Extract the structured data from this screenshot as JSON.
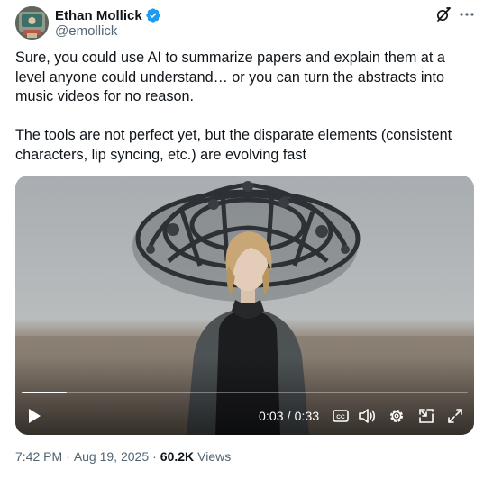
{
  "author": {
    "display_name": "Ethan Mollick",
    "handle": "@emollick",
    "verified": true
  },
  "icons": {
    "avatar": "avatar",
    "verified": "verified-badge-icon",
    "grok": "grok-icon",
    "more": "more-icon",
    "play": "play-icon",
    "captions": "closed-captions-icon",
    "volume": "volume-icon",
    "settings": "gear-icon",
    "pip": "picture-in-picture-icon",
    "fullscreen": "fullscreen-icon"
  },
  "tweet": {
    "paragraphs": [
      "Sure, you could use AI to summarize papers and explain them at a level anyone could understand… or you can turn the abstracts into music videos for no reason.",
      "The tools are not perfect yet, but the disparate elements (consistent characters, lip syncing, etc.) are evolving fast"
    ]
  },
  "video": {
    "current_time": "0:03",
    "duration": "0:33",
    "time_display": "0:03 / 0:33",
    "progress_fraction": 0.1
  },
  "meta": {
    "time": "7:42 PM",
    "date": "Aug 19, 2025",
    "views_count": "60.2K",
    "views_label": "Views",
    "separator": "·"
  },
  "colors": {
    "text_primary": "#0f1419",
    "text_secondary": "#536471",
    "verified_blue": "#1d9bf0"
  }
}
